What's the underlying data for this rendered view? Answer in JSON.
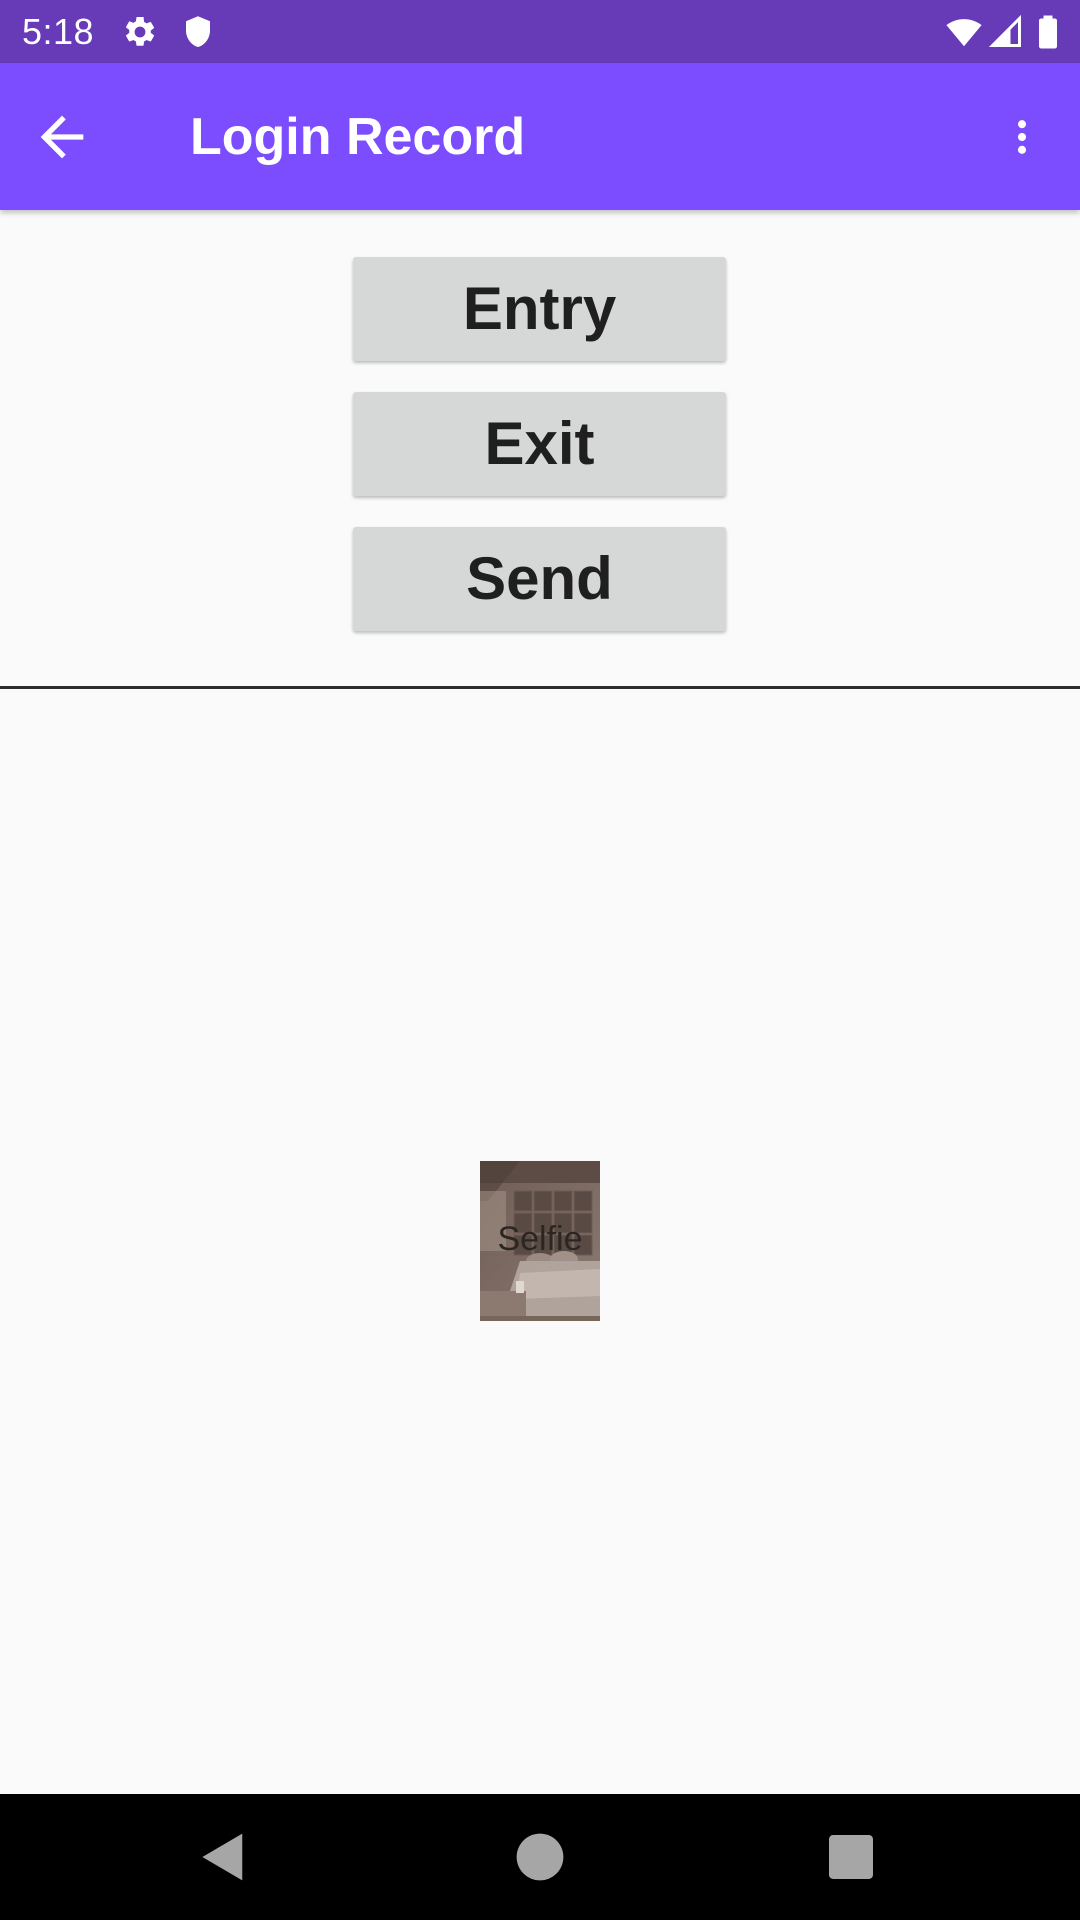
{
  "status_bar": {
    "time": "5:18",
    "icons": [
      "settings-gear-icon",
      "shield-icon",
      "wifi-icon",
      "cell-signal-icon",
      "battery-icon"
    ],
    "background": "#673ab7"
  },
  "app_bar": {
    "title": "Login Record",
    "back_icon": "arrow-back-icon",
    "overflow_icon": "more-vert-icon",
    "background": "#7c4dff"
  },
  "buttons": {
    "entry": "Entry",
    "exit": "Exit",
    "send": "Send"
  },
  "selfie": {
    "label": "Selfie"
  },
  "nav_bar": {
    "icons": [
      "nav-back-icon",
      "nav-home-icon",
      "nav-recents-icon"
    ]
  }
}
